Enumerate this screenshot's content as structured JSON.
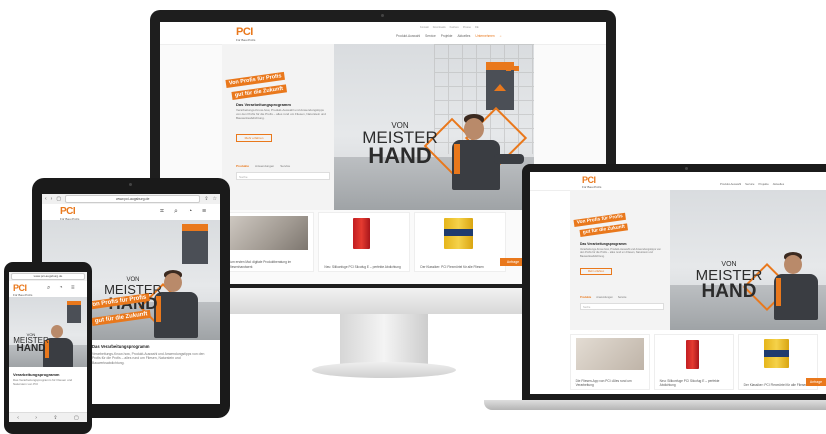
{
  "brand": {
    "logo": "PCI",
    "tagline": "Für Bau-Profis",
    "accent": "#e9781c",
    "dark": "#2c2c2c"
  },
  "nav": {
    "items": [
      "Produkt-Auswahl",
      "Service",
      "Projekte",
      "Aktuelles",
      "Unternehmen"
    ],
    "utility": [
      "Kontakt",
      "Downloads",
      "Karriere",
      "Presse",
      "DE"
    ]
  },
  "hero": {
    "banner_line1": "Von Profis für Profis",
    "banner_line2": "gut für die Zukunft",
    "von": "VON",
    "meister": "MEISTER",
    "hand": "HAND",
    "badge": "PCI",
    "section_title": "Das Verarbeitungsprogramm",
    "section_text": "Verarbeitungs-Know-how, Produkt-Auswahl und Anwendungstipps von den Profis für die Profis – alles rund um Fliesen, Naturstein und Bauwerksabdichtung.",
    "more_button": "Mehr erfahren"
  },
  "search": {
    "tabs": [
      "Produkte",
      "Anwendungen",
      "Service"
    ],
    "placeholder": "Suche"
  },
  "cards": [
    {
      "caption": "Zum ersten Mal: digitale Produktberatung im Fliesenhandwerk",
      "icon": "stone-image"
    },
    {
      "caption": "Die Fliesen-App von PCI: Alles rund um Verarbeitung",
      "icon": "phone-image"
    },
    {
      "caption": "Neu: Silikonfuge PCI Silcofug E – perfekte Abdichtung",
      "icon": "tube-image"
    },
    {
      "caption": "Der Klassiker: PCI Flexmörtel für alle Fliesen",
      "icon": "bucket-image"
    }
  ],
  "side_tab": "Anfrage",
  "browser": {
    "tablet_url": "www.pci-augsburg.de",
    "phone_url": "www.pci-augsburg.de"
  },
  "phone": {
    "heading": "Verarbeitungsprogramm",
    "intro": "Das Verarbeitungsprogramm für Fliesen und Naturstein von PCI"
  }
}
